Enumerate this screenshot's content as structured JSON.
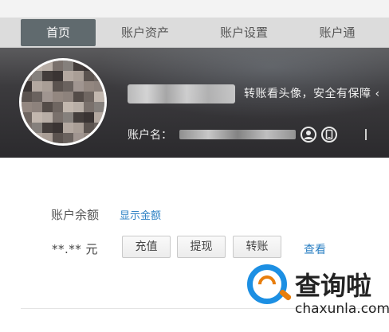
{
  "nav": {
    "items": [
      {
        "label": "首页",
        "active": true
      },
      {
        "label": "账户资产",
        "active": false
      },
      {
        "label": "账户设置",
        "active": false
      },
      {
        "label": "账户通",
        "active": false
      }
    ]
  },
  "banner": {
    "tip": "转账看头像，安全有保障 ‹",
    "account_label": "账户名：",
    "icons": [
      "user-circle-icon",
      "phone-circle-icon"
    ]
  },
  "balance": {
    "label": "账户余额",
    "show_link": "显示金额",
    "amount": "**.** 元",
    "buttons": {
      "recharge": "充值",
      "withdraw": "提现",
      "transfer": "转账"
    },
    "view_link": "查看"
  },
  "watermark": {
    "text": "查询啦",
    "domain": "chaxunla.com"
  },
  "colors": {
    "nav_active_bg": "#606a6e",
    "link": "#2a7fc3",
    "watermark_blue": "#1c8fe3",
    "watermark_orange": "#e87e0c"
  }
}
